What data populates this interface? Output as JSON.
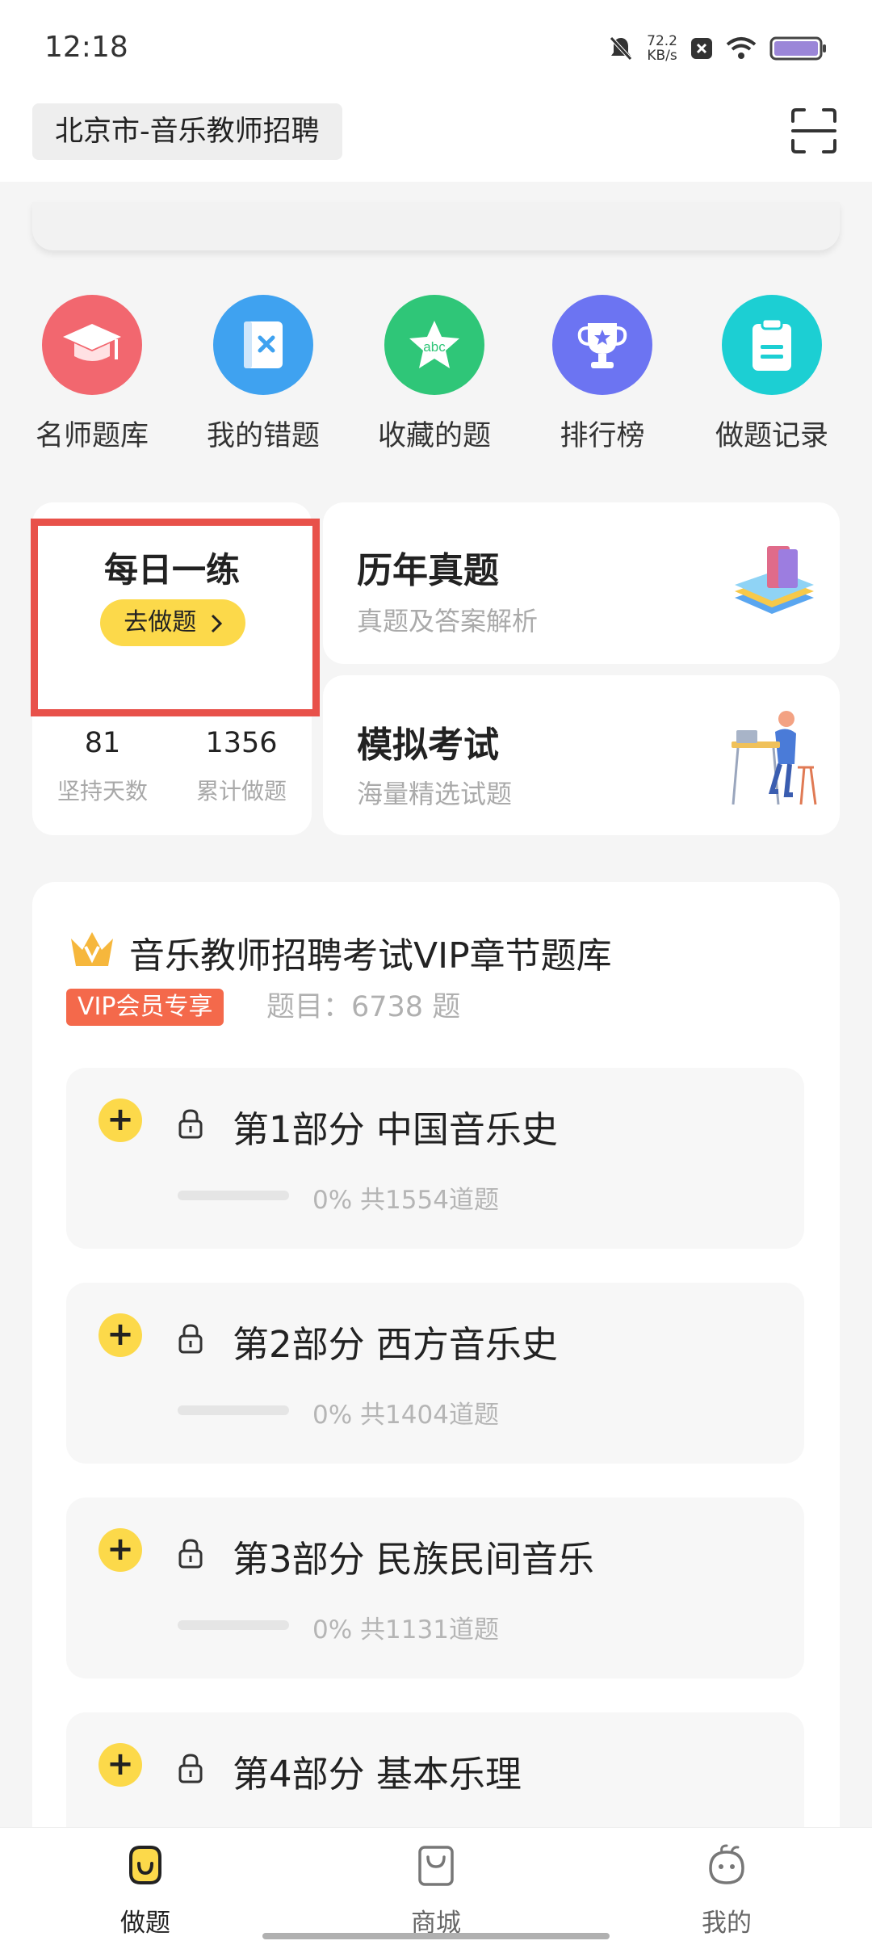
{
  "status_bar": {
    "time": "12:18",
    "net_speed_value": "72.2",
    "net_speed_unit": "KB/s"
  },
  "header": {
    "location": "北京市-音乐教师招聘"
  },
  "quick_icons": [
    {
      "label": "名师题库",
      "icon": "graduation-cap-icon",
      "color": "#f2676f"
    },
    {
      "label": "我的错题",
      "icon": "error-book-icon",
      "color": "#3fa2f0"
    },
    {
      "label": "收藏的题",
      "icon": "abc-star-icon",
      "color": "#2fc678"
    },
    {
      "label": "排行榜",
      "icon": "trophy-icon",
      "color": "#6c74f2"
    },
    {
      "label": "做题记录",
      "icon": "clipboard-icon",
      "color": "#1ccfd3"
    }
  ],
  "daily": {
    "title": "每日一练",
    "button": "去做题",
    "streak_days": "81",
    "streak_label": "坚持天数",
    "total_done": "1356",
    "total_label": "累计做题"
  },
  "past_exams": {
    "title": "历年真题",
    "subtitle": "真题及答案解析"
  },
  "mock_exam": {
    "title": "模拟考试",
    "subtitle": "海量精选试题"
  },
  "vip": {
    "title": "音乐教师招聘考试VIP章节题库",
    "badge": "VIP会员专享",
    "count": "题目：6738 题"
  },
  "chapters": [
    {
      "title": "第1部分  中国音乐史",
      "progress": "0%",
      "total": "共1554道题",
      "fraction": 0
    },
    {
      "title": "第2部分  西方音乐史",
      "progress": "0%",
      "total": "共1404道题",
      "fraction": 0
    },
    {
      "title": "第3部分  民族民间音乐",
      "progress": "0%",
      "total": "共1131道题",
      "fraction": 0
    },
    {
      "title": "第4部分  基本乐理",
      "progress": "",
      "total": "",
      "fraction": 0
    }
  ],
  "tabbar": [
    {
      "label": "做题",
      "icon": "practice-tab-icon",
      "active": true
    },
    {
      "label": "商城",
      "icon": "shopping-bag-icon",
      "active": false
    },
    {
      "label": "我的",
      "icon": "profile-tab-icon",
      "active": false
    }
  ],
  "colors": {
    "accent": "#fcd94a",
    "highlight": "#e8514a",
    "vip_badge": "#f4694b"
  }
}
